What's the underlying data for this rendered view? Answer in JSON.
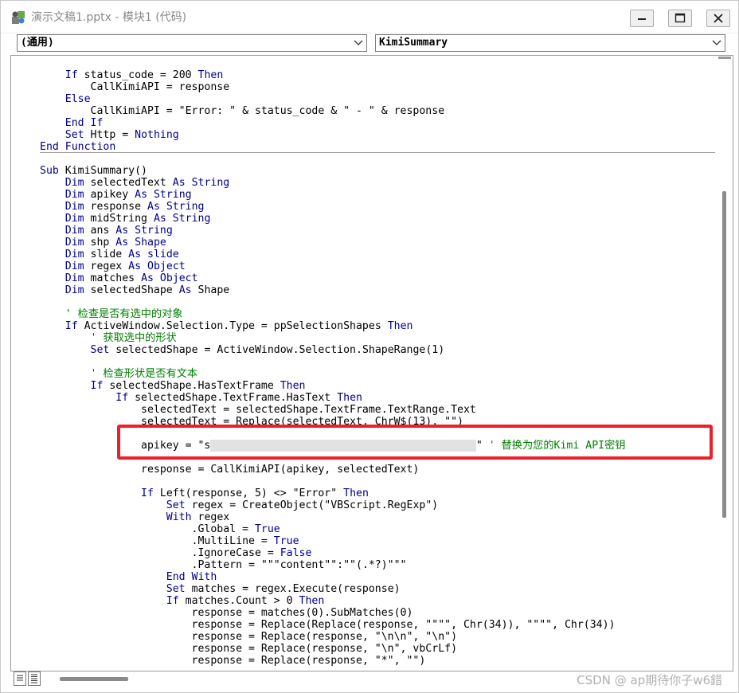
{
  "window": {
    "title": "演示文稿1.pptx - 模块1 (代码)"
  },
  "dropdowns": {
    "object": "(通用)",
    "procedure": "KimiSummary"
  },
  "code_lines": [
    {
      "line": 1,
      "segments": [
        {
          "t": "    "
        },
        {
          "t": "If",
          "k": "kw"
        },
        {
          "t": " status_code = 200 "
        },
        {
          "t": "Then",
          "k": "kw"
        }
      ]
    },
    {
      "line": 2,
      "segments": [
        {
          "t": "        CallKimiAPI = response"
        }
      ]
    },
    {
      "line": 3,
      "segments": [
        {
          "t": "    "
        },
        {
          "t": "Else",
          "k": "kw"
        }
      ]
    },
    {
      "line": 4,
      "segments": [
        {
          "t": "        CallKimiAPI = \"Error: \" & status_code & \" - \" & response"
        }
      ]
    },
    {
      "line": 5,
      "segments": [
        {
          "t": "    "
        },
        {
          "t": "End If",
          "k": "kw"
        }
      ]
    },
    {
      "line": 6,
      "segments": [
        {
          "t": "    "
        },
        {
          "t": "Set",
          "k": "kw"
        },
        {
          "t": " Http = "
        },
        {
          "t": "Nothing",
          "k": "kw"
        }
      ]
    },
    {
      "line": 7,
      "segments": [
        {
          "t": "End Function",
          "k": "kw"
        }
      ]
    },
    {
      "line": 9,
      "segments": [
        {
          "t": "Sub",
          "k": "kw"
        },
        {
          "t": " KimiSummary()"
        }
      ]
    },
    {
      "line": 10,
      "segments": [
        {
          "t": "    "
        },
        {
          "t": "Dim",
          "k": "kw"
        },
        {
          "t": " selectedText "
        },
        {
          "t": "As",
          "k": "kw"
        },
        {
          "t": " "
        },
        {
          "t": "String",
          "k": "kw"
        }
      ]
    },
    {
      "line": 11,
      "segments": [
        {
          "t": "    "
        },
        {
          "t": "Dim",
          "k": "kw"
        },
        {
          "t": " apikey "
        },
        {
          "t": "As",
          "k": "kw"
        },
        {
          "t": " "
        },
        {
          "t": "String",
          "k": "kw"
        }
      ]
    },
    {
      "line": 12,
      "segments": [
        {
          "t": "    "
        },
        {
          "t": "Dim",
          "k": "kw"
        },
        {
          "t": " response "
        },
        {
          "t": "As",
          "k": "kw"
        },
        {
          "t": " "
        },
        {
          "t": "String",
          "k": "kw"
        }
      ]
    },
    {
      "line": 13,
      "segments": [
        {
          "t": "    "
        },
        {
          "t": "Dim",
          "k": "kw"
        },
        {
          "t": " midString "
        },
        {
          "t": "As",
          "k": "kw"
        },
        {
          "t": " "
        },
        {
          "t": "String",
          "k": "kw"
        }
      ]
    },
    {
      "line": 14,
      "segments": [
        {
          "t": "    "
        },
        {
          "t": "Dim",
          "k": "kw"
        },
        {
          "t": " ans "
        },
        {
          "t": "As",
          "k": "kw"
        },
        {
          "t": " "
        },
        {
          "t": "String",
          "k": "kw"
        }
      ]
    },
    {
      "line": 15,
      "segments": [
        {
          "t": "    "
        },
        {
          "t": "Dim",
          "k": "kw"
        },
        {
          "t": " shp "
        },
        {
          "t": "As",
          "k": "kw"
        },
        {
          "t": " "
        },
        {
          "t": "Shape",
          "k": "kw"
        }
      ]
    },
    {
      "line": 16,
      "segments": [
        {
          "t": "    "
        },
        {
          "t": "Dim",
          "k": "kw"
        },
        {
          "t": " slide "
        },
        {
          "t": "As",
          "k": "kw"
        },
        {
          "t": " "
        },
        {
          "t": "slide",
          "k": "kw"
        }
      ]
    },
    {
      "line": 17,
      "segments": [
        {
          "t": "    "
        },
        {
          "t": "Dim",
          "k": "kw"
        },
        {
          "t": " regex "
        },
        {
          "t": "As",
          "k": "kw"
        },
        {
          "t": " "
        },
        {
          "t": "Object",
          "k": "kw"
        }
      ]
    },
    {
      "line": 18,
      "segments": [
        {
          "t": "    "
        },
        {
          "t": "Dim",
          "k": "kw"
        },
        {
          "t": " matches "
        },
        {
          "t": "As",
          "k": "kw"
        },
        {
          "t": " "
        },
        {
          "t": "Object",
          "k": "kw"
        }
      ]
    },
    {
      "line": 19,
      "segments": [
        {
          "t": "    "
        },
        {
          "t": "Dim",
          "k": "kw"
        },
        {
          "t": " selectedShape "
        },
        {
          "t": "As",
          "k": "kw"
        },
        {
          "t": " Shape"
        }
      ]
    },
    {
      "line": 21,
      "segments": [
        {
          "t": "    "
        },
        {
          "t": "' 检查是否有选中的对象",
          "k": "cm"
        }
      ]
    },
    {
      "line": 22,
      "segments": [
        {
          "t": "    "
        },
        {
          "t": "If",
          "k": "kw"
        },
        {
          "t": " ActiveWindow.Selection.Type = ppSelectionShapes "
        },
        {
          "t": "Then",
          "k": "kw"
        }
      ]
    },
    {
      "line": 23,
      "segments": [
        {
          "t": "        "
        },
        {
          "t": "' 获取选中的形状",
          "k": "cm"
        }
      ]
    },
    {
      "line": 24,
      "segments": [
        {
          "t": "        "
        },
        {
          "t": "Set",
          "k": "kw"
        },
        {
          "t": " selectedShape = ActiveWindow.Selection.ShapeRange(1)"
        }
      ]
    },
    {
      "line": 26,
      "segments": [
        {
          "t": "        "
        },
        {
          "t": "' 检查形状是否有文本",
          "k": "cm"
        }
      ]
    },
    {
      "line": 27,
      "segments": [
        {
          "t": "        "
        },
        {
          "t": "If",
          "k": "kw"
        },
        {
          "t": " selectedShape.HasTextFrame "
        },
        {
          "t": "Then",
          "k": "kw"
        }
      ]
    },
    {
      "line": 28,
      "segments": [
        {
          "t": "            "
        },
        {
          "t": "If",
          "k": "kw"
        },
        {
          "t": " selectedShape.TextFrame.HasText "
        },
        {
          "t": "Then",
          "k": "kw"
        }
      ]
    },
    {
      "line": 29,
      "segments": [
        {
          "t": "                selectedText = selectedShape.TextFrame.TextRange.Text"
        }
      ]
    },
    {
      "line": 30,
      "segments": [
        {
          "t": "                selectedText = Replace(selectedText, ChrW$(13), \"\")"
        }
      ]
    },
    {
      "line": 32,
      "segments": [
        {
          "t": "                apikey = \"s"
        },
        {
          "t": "                                          ",
          "k": "blur"
        },
        {
          "t": "\" "
        },
        {
          "t": "' 替换为您的Kimi API密钥",
          "k": "cm"
        }
      ]
    },
    {
      "line": 34,
      "segments": [
        {
          "t": "                response = CallKimiAPI(apikey, selectedText)"
        }
      ]
    },
    {
      "line": 36,
      "segments": [
        {
          "t": "                "
        },
        {
          "t": "If",
          "k": "kw"
        },
        {
          "t": " Left(response, 5) <> \"Error\" "
        },
        {
          "t": "Then",
          "k": "kw"
        }
      ]
    },
    {
      "line": 37,
      "segments": [
        {
          "t": "                    "
        },
        {
          "t": "Set",
          "k": "kw"
        },
        {
          "t": " regex = CreateObject(\"VBScript.RegExp\")"
        }
      ]
    },
    {
      "line": 38,
      "segments": [
        {
          "t": "                    "
        },
        {
          "t": "With",
          "k": "kw"
        },
        {
          "t": " regex"
        }
      ]
    },
    {
      "line": 39,
      "segments": [
        {
          "t": "                        .Global = "
        },
        {
          "t": "True",
          "k": "kw"
        }
      ]
    },
    {
      "line": 40,
      "segments": [
        {
          "t": "                        .MultiLine = "
        },
        {
          "t": "True",
          "k": "kw"
        }
      ]
    },
    {
      "line": 41,
      "segments": [
        {
          "t": "                        .IgnoreCase = "
        },
        {
          "t": "False",
          "k": "kw"
        }
      ]
    },
    {
      "line": 42,
      "segments": [
        {
          "t": "                        .Pattern = \"\"\"content\"\":\"\"(.*?)\"\"\""
        }
      ]
    },
    {
      "line": 43,
      "segments": [
        {
          "t": "                    "
        },
        {
          "t": "End With",
          "k": "kw"
        }
      ]
    },
    {
      "line": 44,
      "segments": [
        {
          "t": "                    "
        },
        {
          "t": "Set",
          "k": "kw"
        },
        {
          "t": " matches = regex.Execute(response)"
        }
      ]
    },
    {
      "line": 45,
      "segments": [
        {
          "t": "                    "
        },
        {
          "t": "If",
          "k": "kw"
        },
        {
          "t": " matches.Count > 0 "
        },
        {
          "t": "Then",
          "k": "kw"
        }
      ]
    },
    {
      "line": 46,
      "segments": [
        {
          "t": "                        response = matches(0).SubMatches(0)"
        }
      ]
    },
    {
      "line": 47,
      "segments": [
        {
          "t": "                        response = Replace(Replace(response, \"\"\"\", Chr(34)), \"\"\"\", Chr(34))"
        }
      ]
    },
    {
      "line": 48,
      "segments": [
        {
          "t": "                        response = Replace(response, \"\\n\\n\", \"\\n\")"
        }
      ]
    },
    {
      "line": 49,
      "segments": [
        {
          "t": "                        response = Replace(response, \"\\n\", vbCrLf)"
        }
      ]
    },
    {
      "line": 50,
      "segments": [
        {
          "t": "                        response = Replace(response, \"*\", \"\")"
        }
      ]
    }
  ],
  "watermark": "CSDN @ ap期待你子w6錯 ",
  "colors": {
    "keyword": "#00008b",
    "comment": "#008000",
    "annotation_box": "#e8212b"
  },
  "icons": {
    "app": "vba-editor-icon",
    "minimize": "minimize-icon",
    "maximize": "maximize-icon",
    "close": "close-icon"
  }
}
